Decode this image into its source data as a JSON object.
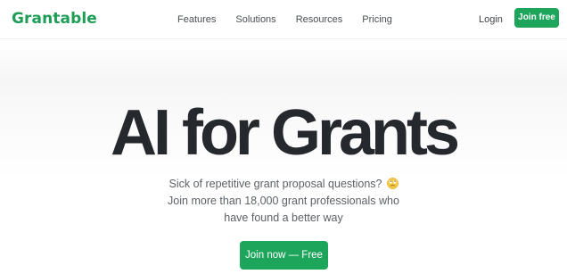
{
  "brand": {
    "logo_text": "Grantable",
    "accent_color": "#1ea55c"
  },
  "nav": {
    "features": "Features",
    "solutions": "Solutions",
    "resources": "Resources",
    "pricing": "Pricing"
  },
  "header": {
    "login": "Login",
    "join_free": "Join free"
  },
  "hero": {
    "title": "AI for Grants",
    "subtitle_line_1": "Sick of repetitive grant proposal questions?",
    "subtitle_emoji": "face-with-rolling-eyes-icon",
    "subtitle_line_2": "Join more than 18,000 grant professionals who",
    "subtitle_line_3": "have found a better way",
    "cta": "Join now — Free"
  }
}
